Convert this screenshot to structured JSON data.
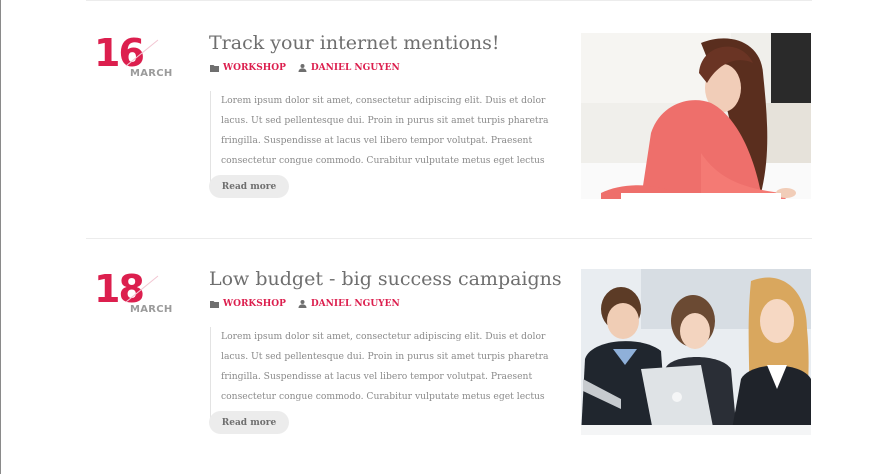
{
  "posts": [
    {
      "day": "16",
      "month": "MARCH",
      "title": "Track your internet mentions!",
      "category": "WORKSHOP",
      "author": "DANIEL NGUYEN",
      "excerpt": "Lorem ipsum dolor sit amet, consectetur adipiscing elit. Duis et dolor lacus. Ut sed pellentesque dui. Proin in purus sit amet turpis pharetra fringilla. Suspendisse at lacus vel libero tempor volutpat. Praesent consectetur congue commodo. Curabitur vulputate metus eget lectus convallis",
      "read_more": "Read more",
      "image": "photo-woman-writing"
    },
    {
      "day": "18",
      "month": "MARCH",
      "title": "Low budget - big success campaigns",
      "category": "WORKSHOP",
      "author": "DANIEL NGUYEN",
      "excerpt": "Lorem ipsum dolor sit amet, consectetur adipiscing elit. Duis et dolor lacus. Ut sed pellentesque dui. Proin in purus sit amet turpis pharetra fringilla. Suspendisse at lacus vel libero tempor volutpat. Praesent consectetur congue commodo. Curabitur vulputate metus eget lectus convallis",
      "read_more": "Read more",
      "image": "photo-students-laptop"
    }
  ],
  "colors": {
    "accent": "#dc1f4e",
    "title": "#6f6f6f",
    "text": "#8a8a8a",
    "button_bg": "#ececec"
  },
  "icons": {
    "category": "folder-icon",
    "author": "user-icon"
  }
}
